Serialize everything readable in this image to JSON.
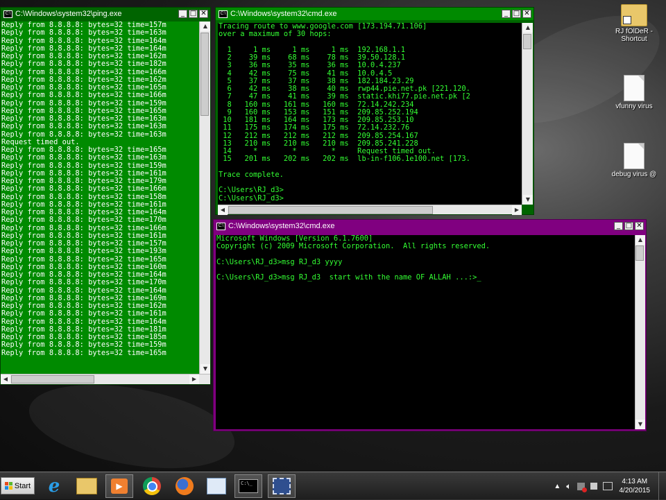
{
  "colors": {
    "ping_bg": "#008a00",
    "ping_title": "#006400",
    "cmd1_title": "#008a00",
    "cmd2_title": "#800080",
    "console_text_white": "#ffffff",
    "console_text_green": "#33ff33"
  },
  "ping_window": {
    "title": "C:\\Windows\\system32\\ping.exe",
    "lines": [
      "Reply from 8.8.8.8: bytes=32 time=157m",
      "Reply from 8.8.8.8: bytes=32 time=163m",
      "Reply from 8.8.8.8: bytes=32 time=164m",
      "Reply from 8.8.8.8: bytes=32 time=164m",
      "Reply from 8.8.8.8: bytes=32 time=162m",
      "Reply from 8.8.8.8: bytes=32 time=182m",
      "Reply from 8.8.8.8: bytes=32 time=166m",
      "Reply from 8.8.8.8: bytes=32 time=162m",
      "Reply from 8.8.8.8: bytes=32 time=165m",
      "Reply from 8.8.8.8: bytes=32 time=166m",
      "Reply from 8.8.8.8: bytes=32 time=159m",
      "Reply from 8.8.8.8: bytes=32 time=165m",
      "Reply from 8.8.8.8: bytes=32 time=163m",
      "Reply from 8.8.8.8: bytes=32 time=163m",
      "Reply from 8.8.8.8: bytes=32 time=163m",
      "Request timed out.",
      "Reply from 8.8.8.8: bytes=32 time=165m",
      "Reply from 8.8.8.8: bytes=32 time=163m",
      "Reply from 8.8.8.8: bytes=32 time=159m",
      "Reply from 8.8.8.8: bytes=32 time=161m",
      "Reply from 8.8.8.8: bytes=32 time=179m",
      "Reply from 8.8.8.8: bytes=32 time=166m",
      "Reply from 8.8.8.8: bytes=32 time=158m",
      "Reply from 8.8.8.8: bytes=32 time=161m",
      "Reply from 8.8.8.8: bytes=32 time=164m",
      "Reply from 8.8.8.8: bytes=32 time=170m",
      "Reply from 8.8.8.8: bytes=32 time=166m",
      "Reply from 8.8.8.8: bytes=32 time=161m",
      "Reply from 8.8.8.8: bytes=32 time=157m",
      "Reply from 8.8.8.8: bytes=32 time=193m",
      "Reply from 8.8.8.8: bytes=32 time=165m",
      "Reply from 8.8.8.8: bytes=32 time=160m",
      "Reply from 8.8.8.8: bytes=32 time=164m",
      "Reply from 8.8.8.8: bytes=32 time=170m",
      "Reply from 8.8.8.8: bytes=32 time=164m",
      "Reply from 8.8.8.8: bytes=32 time=169m",
      "Reply from 8.8.8.8: bytes=32 time=162m",
      "Reply from 8.8.8.8: bytes=32 time=161m",
      "Reply from 8.8.8.8: bytes=32 time=164m",
      "Reply from 8.8.8.8: bytes=32 time=181m",
      "Reply from 8.8.8.8: bytes=32 time=185m",
      "Reply from 8.8.8.8: bytes=32 time=159m",
      "Reply from 8.8.8.8: bytes=32 time=165m"
    ]
  },
  "tracert_window": {
    "title": "C:\\Windows\\system32\\cmd.exe",
    "lines": [
      "Tracing route to www.google.com [173.194.71.106]",
      "over a maximum of 30 hops:",
      "",
      "  1     1 ms     1 ms     1 ms  192.168.1.1",
      "  2    39 ms    68 ms    78 ms  39.50.128.1",
      "  3    36 ms    35 ms    36 ms  10.0.4.237",
      "  4    42 ms    75 ms    41 ms  10.0.4.5",
      "  5    37 ms    37 ms    38 ms  182.184.23.29",
      "  6    42 ms    38 ms    40 ms  rwp44.pie.net.pk [221.120.",
      "  7    47 ms    41 ms    39 ms  static.khi77.pie.net.pk [2",
      "  8   160 ms   161 ms   160 ms  72.14.242.234",
      "  9   160 ms   153 ms   151 ms  209.85.252.194",
      " 10   181 ms   164 ms   173 ms  209.85.253.10",
      " 11   175 ms   174 ms   175 ms  72.14.232.76",
      " 12   212 ms   212 ms   212 ms  209.85.254.167",
      " 13   210 ms   210 ms   210 ms  209.85.241.228",
      " 14     *        *        *     Request timed out.",
      " 15   201 ms   202 ms   202 ms  lb-in-f106.1e100.net [173.",
      "",
      "Trace complete.",
      "",
      "C:\\Users\\RJ_d3>",
      "C:\\Users\\RJ_d3>"
    ]
  },
  "msg_window": {
    "title": "C:\\Windows\\system32\\cmd.exe",
    "lines": [
      "Microsoft Windows [Version 6.1.7600]",
      "Copyright (c) 2009 Microsoft Corporation.  All rights reserved.",
      "",
      "C:\\Users\\RJ_d3>msg RJ_d3 yyyy",
      "",
      "C:\\Users\\RJ_d3>msg RJ_d3  start with the name OF ALLAH ...:>_"
    ]
  },
  "window_controls": {
    "minimize": "_",
    "maximize": "□",
    "close": "✕"
  },
  "desktop_icons": [
    {
      "label": "RJ fOlDeR - Shortcut",
      "icon": "folder-shortcut-icon"
    },
    {
      "label": "vfunny virus",
      "icon": "document-icon"
    },
    {
      "label": "debug virus @",
      "icon": "document-icon"
    }
  ],
  "taskbar": {
    "start_label": "Start",
    "buttons": [
      {
        "name": "internet-explorer",
        "icon": "ie-icon"
      },
      {
        "name": "file-explorer",
        "icon": "folder-icon"
      },
      {
        "name": "media-player",
        "icon": "media-player-icon"
      },
      {
        "name": "chrome",
        "icon": "chrome-icon"
      },
      {
        "name": "firefox",
        "icon": "firefox-icon"
      },
      {
        "name": "notepad",
        "icon": "notepad-icon"
      },
      {
        "name": "cmd",
        "icon": "cmd-icon"
      },
      {
        "name": "video",
        "icon": "film-icon"
      }
    ],
    "clock_time": "4:13 AM",
    "clock_date": "4/20/2015"
  }
}
